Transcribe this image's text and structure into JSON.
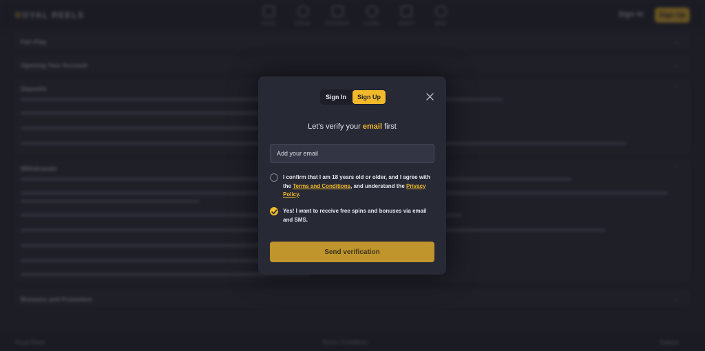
{
  "background": {
    "logo": {
      "first": "R",
      "rest": "OYAL REELS"
    },
    "nav": [
      {
        "label": "Home",
        "icon": "home-icon"
      },
      {
        "label": "Casino",
        "icon": "casino-icon"
      },
      {
        "label": "Promotions",
        "icon": "gift-icon"
      },
      {
        "label": "Loyalty",
        "icon": "crown-icon"
      },
      {
        "label": "Search",
        "icon": "search-icon"
      },
      {
        "label": "More",
        "icon": "more-icon"
      }
    ],
    "sign_in": "Sign In",
    "sign_up": "Sign Up",
    "faq": [
      {
        "title": "Fair Play"
      },
      {
        "title": "Opening Your Account"
      },
      {
        "title": "Deposits"
      },
      {
        "title": "Withdrawals"
      },
      {
        "title": "Bonuses and Promotion"
      }
    ],
    "footer": {
      "left": "Royal Reels",
      "middle": "Terms | Conditions",
      "right": "Support"
    }
  },
  "modal": {
    "tabs": {
      "sign_in": "Sign In",
      "sign_up": "Sign Up",
      "active": "sign_up"
    },
    "heading": {
      "prefix": "Let's verify your ",
      "emphasis": "email",
      "suffix": " first"
    },
    "email_placeholder": "Add your email",
    "consent": {
      "line1": "I confirm that I am 18 years old or older, and I agree with the ",
      "terms_link": "Terms and Conditions",
      "line2": ", and understand the ",
      "privacy_link": "Privacy Policy",
      "line3": ".",
      "checked": false
    },
    "marketing": {
      "text": "Yes! I want to receive free spins and bonuses via email and SMS.",
      "checked": true
    },
    "submit_label": "Send verification"
  },
  "colors": {
    "accent": "#f2b92b",
    "modal_bg": "#272935",
    "page_bg": "#24252f",
    "button": "#bf952c"
  }
}
